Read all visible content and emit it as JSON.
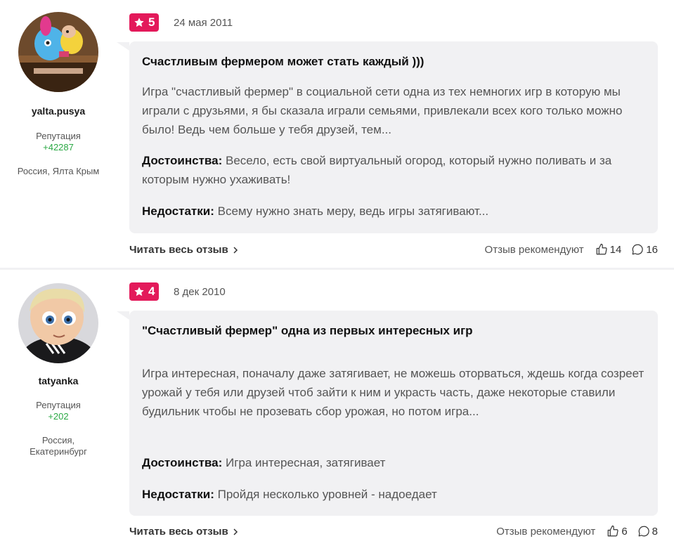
{
  "reviews": [
    {
      "author": "yalta.pusya",
      "reputation_label": "Репутация",
      "reputation": "+42287",
      "location": "Россия, Ялта Крым",
      "rating": "5",
      "date": "24 мая 2011",
      "title": "Счастливым фермером может стать каждый )))",
      "body": "Игра \"счастливый фермер\" в социальной сети одна из тех немногих игр в которую мы играли с друзьями, я бы сказала играли семьями, привлекали всех кого только можно было! Ведь чем больше у тебя друзей, тем...",
      "pros_label": "Достоинства:",
      "pros": "Весело, есть свой виртуальный огород, который нужно поливать и за которым нужно ухаживать!",
      "cons_label": "Недостатки:",
      "cons": "Всему нужно знать меру, ведь игры затягивают...",
      "read_more": "Читать весь отзыв",
      "recommend_label": "Отзыв рекомендуют",
      "likes": "14",
      "comments": "16"
    },
    {
      "author": "tatyanka",
      "reputation_label": "Репутация",
      "reputation": "+202",
      "location_line1": "Россия,",
      "location_line2": "Екатеринбург",
      "rating": "4",
      "date": "8 дек 2010",
      "title": "\"Счастливый фермер\" одна из первых интересных игр",
      "body": "Игра интересная, поначалу даже затягивает, не можешь оторваться, ждешь когда созреет урожай у тебя или друзей чтоб зайти к ним и украсть часть, даже некоторые ставили будильник чтобы не прозевать сбор урожая, но потом игра...",
      "pros_label": "Достоинства:",
      "pros": "Игра интересная, затягивает",
      "cons_label": "Недостатки:",
      "cons": "Пройдя несколько уровней - надоедает",
      "read_more": "Читать весь отзыв",
      "recommend_label": "Отзыв рекомендуют",
      "likes": "6",
      "comments": "8"
    }
  ],
  "icons": {
    "rating": "star-icon",
    "like": "thumbs-up-icon",
    "comment": "comment-icon",
    "more": "chevron-right-icon"
  },
  "colors": {
    "badge": "#e3195a",
    "reputation": "#2aa844",
    "card_bg": "#f1f1f3"
  }
}
